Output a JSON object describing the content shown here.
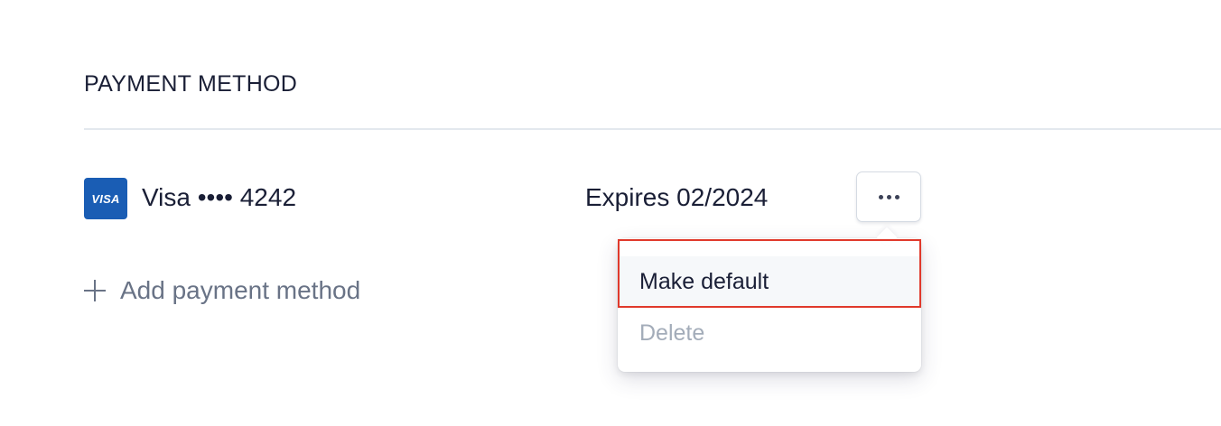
{
  "section": {
    "title": "PAYMENT METHOD"
  },
  "card": {
    "brand_badge": "VISA",
    "label": "Visa •••• 4242",
    "expiry": "Expires 02/2024",
    "brand_color": "#1a5db4"
  },
  "more_button": {
    "icon": "more-horizontal-icon"
  },
  "add_method": {
    "label": "Add payment method",
    "icon": "plus-icon"
  },
  "menu": {
    "items": [
      {
        "label": "Make default",
        "state": "hovered"
      },
      {
        "label": "Delete",
        "state": "disabled"
      }
    ]
  },
  "colors": {
    "text_primary": "#1a1f36",
    "text_muted": "#697386",
    "disabled": "#a3acb9",
    "highlight_outline": "#e0392b"
  }
}
